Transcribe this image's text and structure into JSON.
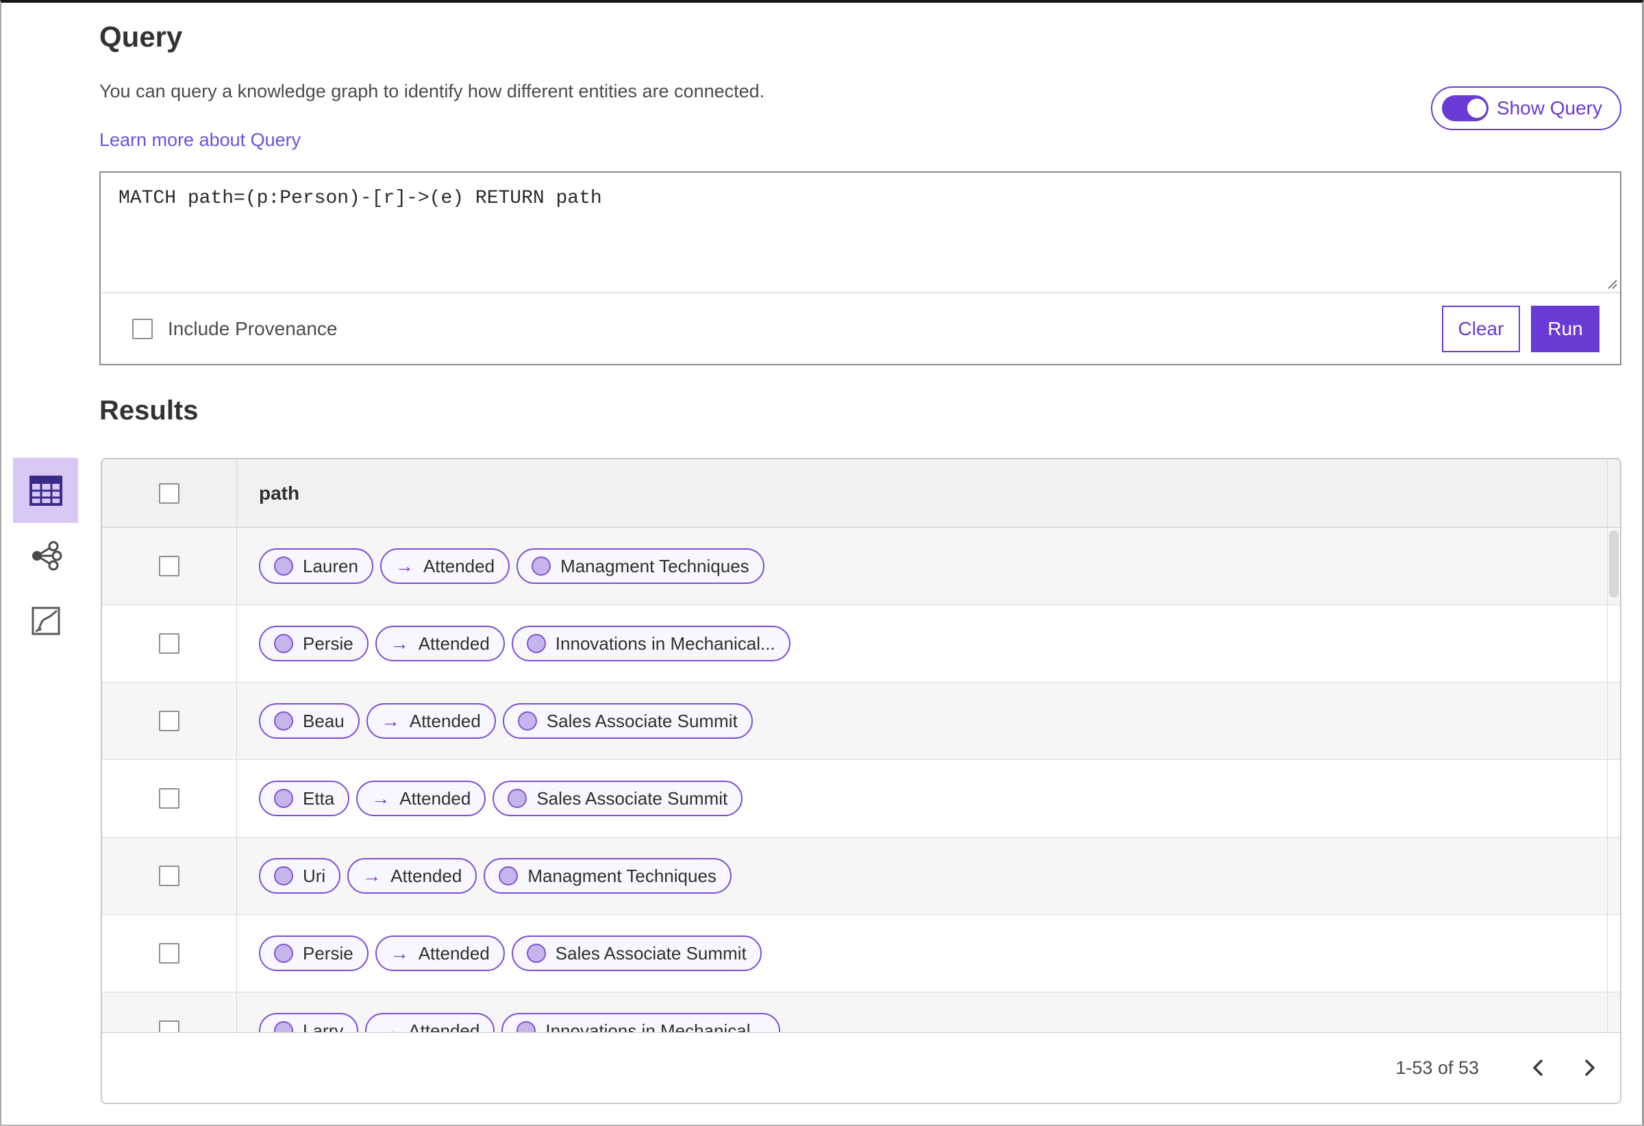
{
  "header": {
    "title": "Query",
    "description": "You can query a knowledge graph to identify how different entities are connected.",
    "learn_more_link": "Learn more about Query",
    "show_query_label": "Show Query",
    "show_query_on": true
  },
  "query": {
    "text": "MATCH path=(p:Person)-[r]->(e) RETURN path",
    "include_provenance_label": "Include Provenance",
    "include_provenance_checked": false,
    "clear_label": "Clear",
    "run_label": "Run"
  },
  "results": {
    "title": "Results",
    "column_header": "path",
    "view_tabs": [
      {
        "name": "table-view",
        "icon": "table-icon",
        "selected": true
      },
      {
        "name": "network-view",
        "icon": "network-icon",
        "selected": false
      },
      {
        "name": "chart-view",
        "icon": "chart-icon",
        "selected": false
      }
    ]
  },
  "table": {
    "edge_arrow": "→",
    "rows": [
      {
        "node1": "Lauren",
        "edge": "Attended",
        "node2": "Managment Techniques"
      },
      {
        "node1": "Persie",
        "edge": "Attended",
        "node2": "Innovations in Mechanical..."
      },
      {
        "node1": "Beau",
        "edge": "Attended",
        "node2": "Sales Associate Summit"
      },
      {
        "node1": "Etta",
        "edge": "Attended",
        "node2": "Sales Associate Summit"
      },
      {
        "node1": "Uri",
        "edge": "Attended",
        "node2": "Managment Techniques"
      },
      {
        "node1": "Persie",
        "edge": "Attended",
        "node2": "Sales Associate Summit"
      },
      {
        "node1": "Larry",
        "edge": "Attended",
        "node2": "Innovations in Mechanical..."
      }
    ]
  },
  "pagination": {
    "range_text": "1-53 of 53",
    "prev_icon": "chevron-left",
    "next_icon": "chevron-right"
  },
  "colors": {
    "accent": "#6a3bd4",
    "pill-border": "#7b4fd8",
    "pill-bg": "#f8f6fe",
    "node-fill": "#c7b4ec",
    "node-stroke": "#7e57d2",
    "selected-tab-bg": "#d9c7f6",
    "icon-purple": "#3a2b8a",
    "link": "#6a52dd"
  }
}
